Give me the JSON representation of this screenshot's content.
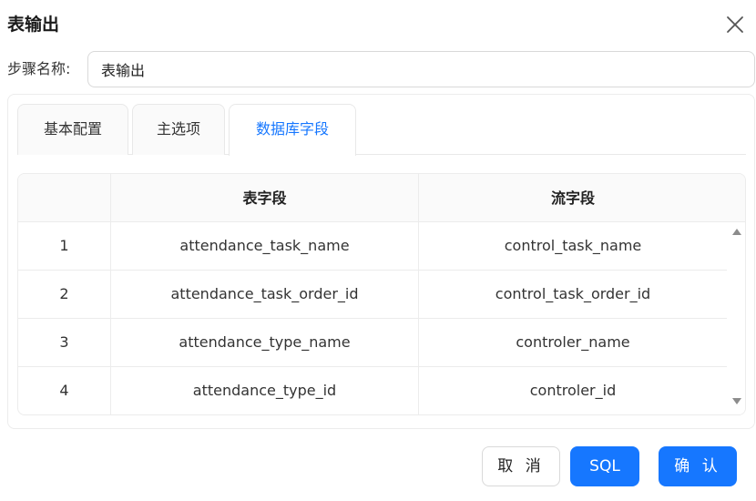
{
  "dialog": {
    "title": "表输出",
    "close_icon": "close-icon"
  },
  "step_name": {
    "label": "步骤名称:",
    "value": "表输出"
  },
  "tabs": [
    {
      "label": "基本配置",
      "active": false
    },
    {
      "label": "主选项",
      "active": false
    },
    {
      "label": "数据库字段",
      "active": true
    }
  ],
  "table": {
    "columns": [
      "",
      "表字段",
      "流字段"
    ],
    "rows": [
      {
        "index": "1",
        "table_field": "attendance_task_name",
        "stream_field": "control_task_name"
      },
      {
        "index": "2",
        "table_field": "attendance_task_order_id",
        "stream_field": "control_task_order_id"
      },
      {
        "index": "3",
        "table_field": "attendance_type_name",
        "stream_field": "controler_name"
      },
      {
        "index": "4",
        "table_field": "attendance_type_id",
        "stream_field": "controler_id"
      }
    ]
  },
  "buttons": {
    "cancel": "取 消",
    "sql": "SQL",
    "ok": "确 认"
  },
  "colors": {
    "accent": "#1677ff",
    "border": "#d9d9d9",
    "header_bg": "#fafafa"
  }
}
